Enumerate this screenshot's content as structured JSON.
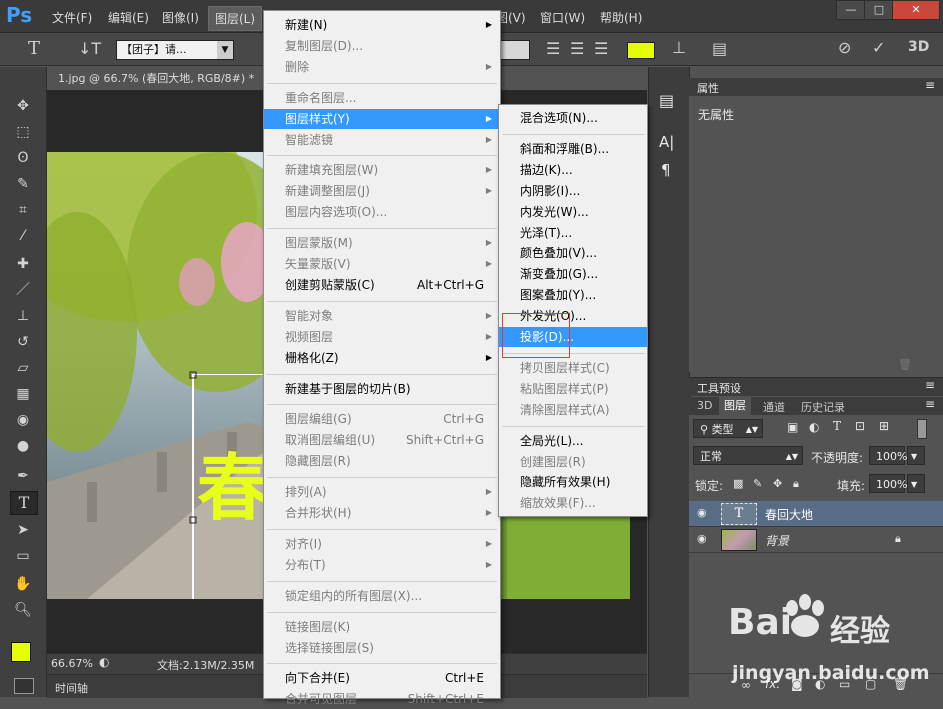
{
  "app": {
    "logo": "Ps"
  },
  "menubar": {
    "items": [
      "文件(F)",
      "编辑(E)",
      "图像(I)",
      "图层(L)",
      "视图(V)",
      "窗口(W)",
      "帮助(H)"
    ],
    "window_buttons": [
      "—",
      "□",
      "✕"
    ]
  },
  "options": {
    "font_family": "【团子】请...",
    "icons": [
      "type-tool-icon",
      "orient-icon",
      "align-left-icon",
      "align-center-icon",
      "align-right-icon",
      "warp-text-icon",
      "panels-icon",
      "cancel-icon",
      "commit-icon",
      "3d-icon"
    ],
    "color_swatch": "#e5ff00",
    "label_3d": "3D"
  },
  "document": {
    "tab_title": "1.jpg @ 66.7% (春回大地, RGB/8#) *",
    "zoom": "66.67%",
    "doc_size": "文档:2.13M/2.35M",
    "canvas_text": "春",
    "timeline_label": "时间轴"
  },
  "colors": {
    "foreground": "#e5ff00",
    "background": "#ffffff",
    "highlight": "#3399ff",
    "canvas_text": "#e8ff1a"
  },
  "properties": {
    "title": "属性",
    "value": "无属性"
  },
  "tool_preset": {
    "title": "工具预设"
  },
  "layers": {
    "tabs": [
      "3D",
      "图层",
      "通道",
      "历史记录"
    ],
    "filter": "类型",
    "blend_mode": "正常",
    "opacity_label": "不透明度:",
    "opacity": "100%",
    "lock_label": "锁定:",
    "fill_label": "填充:",
    "fill": "100%",
    "items": [
      {
        "name": "春回大地",
        "selected": true
      },
      {
        "name": "背景",
        "locked": true
      }
    ],
    "footer_icons": [
      "link-icon",
      "fx-icon",
      "mask-icon",
      "adjustment-icon",
      "group-icon",
      "new-layer-icon",
      "trash-icon"
    ],
    "fx_label": "fx."
  },
  "layer_menu": {
    "items": [
      {
        "label": "新建(N)",
        "sub": true
      },
      {
        "label": "复制图层(D)...",
        "disabled": true
      },
      {
        "label": "删除",
        "disabled": true,
        "sub": true
      },
      {
        "sep": true
      },
      {
        "label": "重命名图层...",
        "disabled": true
      },
      {
        "label": "图层样式(Y)",
        "sub": true,
        "highlight": true
      },
      {
        "label": "智能滤镜",
        "disabled": true,
        "sub": true
      },
      {
        "sep": true
      },
      {
        "label": "新建填充图层(W)",
        "disabled": true,
        "sub": true
      },
      {
        "label": "新建调整图层(J)",
        "disabled": true,
        "sub": true
      },
      {
        "label": "图层内容选项(O)...",
        "disabled": true
      },
      {
        "sep": true
      },
      {
        "label": "图层蒙版(M)",
        "disabled": true,
        "sub": true
      },
      {
        "label": "矢量蒙版(V)",
        "disabled": true,
        "sub": true
      },
      {
        "label": "创建剪贴蒙版(C)",
        "shortcut": "Alt+Ctrl+G"
      },
      {
        "sep": true
      },
      {
        "label": "智能对象",
        "disabled": true,
        "sub": true
      },
      {
        "label": "视频图层",
        "disabled": true,
        "sub": true
      },
      {
        "label": "栅格化(Z)",
        "sub": true
      },
      {
        "sep": true
      },
      {
        "label": "新建基于图层的切片(B)"
      },
      {
        "sep": true
      },
      {
        "label": "图层编组(G)",
        "disabled": true,
        "shortcut": "Ctrl+G"
      },
      {
        "label": "取消图层编组(U)",
        "disabled": true,
        "shortcut": "Shift+Ctrl+G"
      },
      {
        "label": "隐藏图层(R)",
        "disabled": true
      },
      {
        "sep": true
      },
      {
        "label": "排列(A)",
        "disabled": true,
        "sub": true
      },
      {
        "label": "合并形状(H)",
        "disabled": true,
        "sub": true
      },
      {
        "sep": true
      },
      {
        "label": "对齐(I)",
        "disabled": true,
        "sub": true
      },
      {
        "label": "分布(T)",
        "disabled": true,
        "sub": true
      },
      {
        "sep": true
      },
      {
        "label": "锁定组内的所有图层(X)...",
        "disabled": true
      },
      {
        "sep": true
      },
      {
        "label": "链接图层(K)",
        "disabled": true
      },
      {
        "label": "选择链接图层(S)",
        "disabled": true
      },
      {
        "sep": true
      },
      {
        "label": "向下合并(E)",
        "shortcut": "Ctrl+E"
      },
      {
        "label": "合并可见图层",
        "disabled": true,
        "shortcut": "Shift+Ctrl+E"
      }
    ]
  },
  "style_menu": {
    "items": [
      {
        "label": "混合选项(N)..."
      },
      {
        "sep": true
      },
      {
        "label": "斜面和浮雕(B)..."
      },
      {
        "label": "描边(K)..."
      },
      {
        "label": "内阴影(I)..."
      },
      {
        "label": "内发光(W)..."
      },
      {
        "label": "光泽(T)..."
      },
      {
        "label": "颜色叠加(V)..."
      },
      {
        "label": "渐变叠加(G)..."
      },
      {
        "label": "图案叠加(Y)..."
      },
      {
        "label": "外发光(O)..."
      },
      {
        "label": "投影(D)...",
        "highlight": true
      },
      {
        "sep": true
      },
      {
        "label": "拷贝图层样式(C)",
        "disabled": true
      },
      {
        "label": "粘贴图层样式(P)",
        "disabled": true
      },
      {
        "label": "清除图层样式(A)",
        "disabled": true
      },
      {
        "sep": true
      },
      {
        "label": "全局光(L)..."
      },
      {
        "label": "创建图层(R)",
        "disabled": true
      },
      {
        "label": "隐藏所有效果(H)"
      },
      {
        "label": "缩放效果(F)...",
        "disabled": true
      }
    ]
  },
  "watermark": {
    "brand": "Bai",
    "brand2": "经验",
    "url": "jingyan.baidu.com"
  }
}
